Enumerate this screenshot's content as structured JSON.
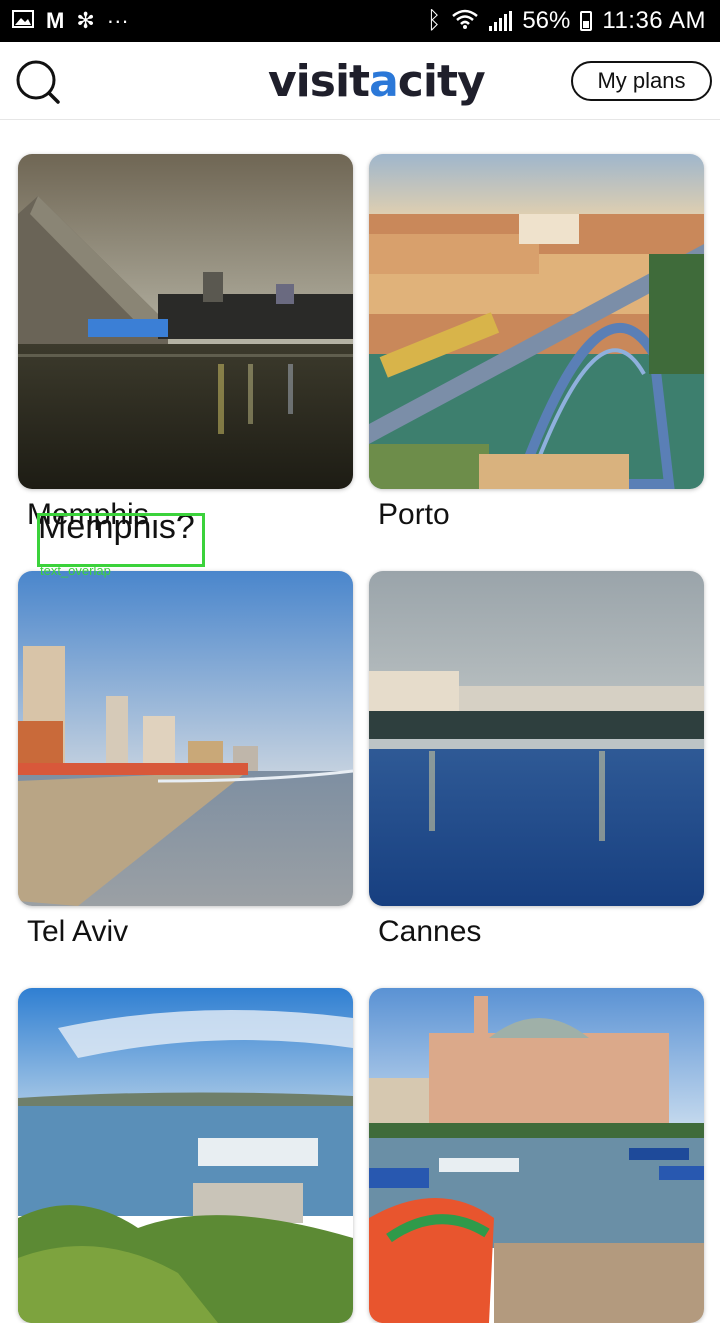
{
  "status_bar": {
    "left_icons": [
      "image-icon",
      "gmail-icon",
      "fan-icon",
      "more-dots-icon"
    ],
    "right_icons": [
      "bluetooth-icon",
      "wifi-icon",
      "signal-icon",
      "battery-icon"
    ],
    "battery": "56%",
    "time": "11:36 AM"
  },
  "header": {
    "logo_pre": "visit",
    "logo_a": "a",
    "logo_post": "city",
    "plans_label": "My plans",
    "brand_color": "#2b78d8"
  },
  "cities": [
    {
      "name": "Memphis"
    },
    {
      "name": "Porto"
    },
    {
      "name": "Tel Aviv"
    },
    {
      "name": "Cannes"
    },
    {
      "name": ""
    },
    {
      "name": ""
    }
  ],
  "overlay": {
    "text": "Memphis?",
    "tag": "text_overlap",
    "color": "#3bd23b"
  }
}
